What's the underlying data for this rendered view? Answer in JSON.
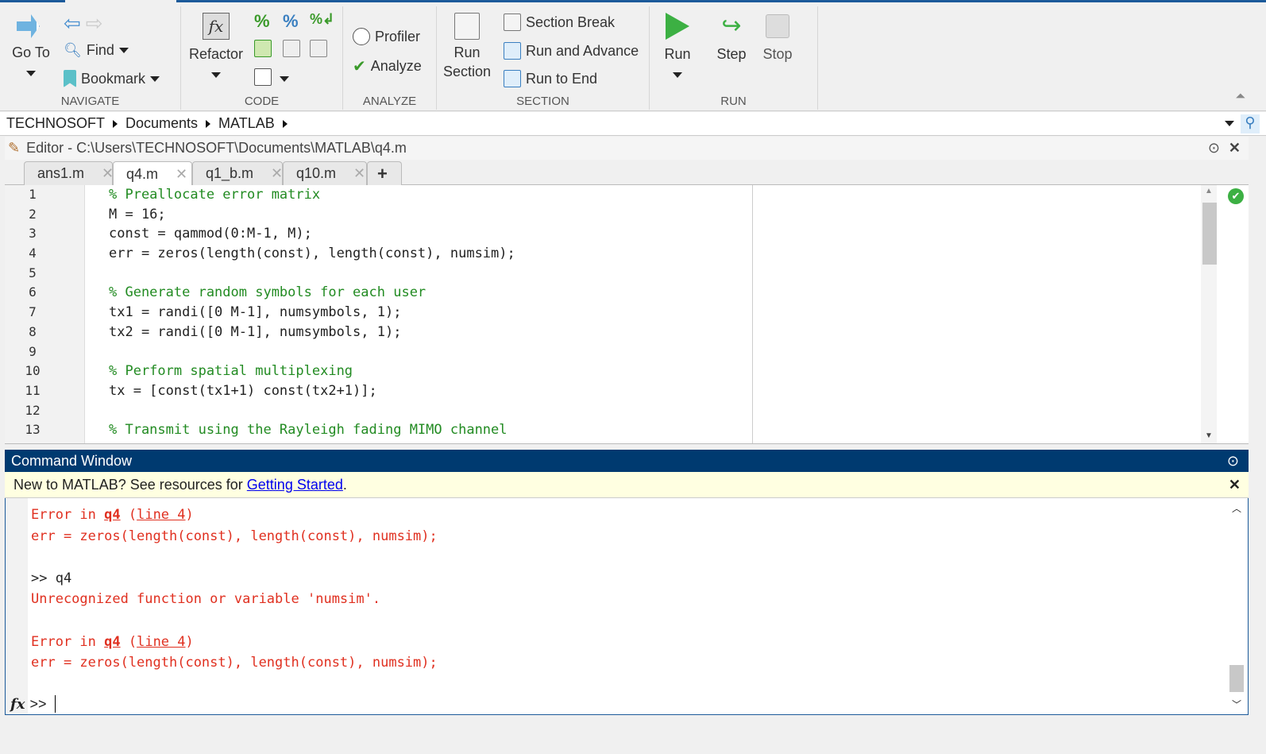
{
  "ribbon": {
    "navigate": {
      "label": "NAVIGATE",
      "goto": "Go To",
      "find": "Find",
      "bookmark": "Bookmark"
    },
    "code": {
      "label": "CODE",
      "refactor": "Refactor"
    },
    "analyze": {
      "label": "ANALYZE",
      "profiler": "Profiler",
      "analyze": "Analyze"
    },
    "section": {
      "label": "SECTION",
      "run_section_1": "Run",
      "run_section_2": "Section",
      "section_break": "Section Break",
      "run_and_advance": "Run and Advance",
      "run_to_end": "Run to End"
    },
    "run": {
      "label": "RUN",
      "run": "Run",
      "step": "Step",
      "stop": "Stop"
    }
  },
  "address": [
    "TECHNOSOFT",
    "Documents",
    "MATLAB"
  ],
  "editor": {
    "title": "Editor - C:\\Users\\TECHNOSOFT\\Documents\\MATLAB\\q4.m",
    "tabs": [
      "ans1.m",
      "q4.m",
      "q1_b.m",
      "q10.m"
    ],
    "active_tab": "q4.m",
    "lines": [
      {
        "n": "1",
        "text": "% Preallocate error matrix",
        "comment": true
      },
      {
        "n": "2",
        "text": "M = 16;"
      },
      {
        "n": "3",
        "text": "const = qammod(0:M-1, M);"
      },
      {
        "n": "4",
        "text": "err = zeros(length(const), length(const), numsim);"
      },
      {
        "n": "5",
        "text": ""
      },
      {
        "n": "6",
        "text": "% Generate random symbols for each user",
        "comment": true
      },
      {
        "n": "7",
        "text": "tx1 = randi([0 M-1], numsymbols, 1);"
      },
      {
        "n": "8",
        "text": "tx2 = randi([0 M-1], numsymbols, 1);"
      },
      {
        "n": "9",
        "text": ""
      },
      {
        "n": "10",
        "text": "% Perform spatial multiplexing",
        "comment": true
      },
      {
        "n": "11",
        "text": "tx = [const(tx1+1) const(tx2+1)];"
      },
      {
        "n": "12",
        "text": ""
      },
      {
        "n": "13",
        "text": "% Transmit using the Rayleigh fading MIMO channel",
        "comment": true
      }
    ]
  },
  "command_window": {
    "title": "Command Window",
    "notice_text": "New to MATLAB? See resources for",
    "notice_link": "Getting Started",
    "notice_end": ".",
    "lines": {
      "e1_prefix": "Error in ",
      "e1_link": "q4",
      "e1_sp": " (",
      "e1_line": "line 4",
      "e1_end": ")",
      "e1_code": "err = zeros(length(const), length(const), numsim);",
      "cmd": ">> q4",
      "msg": "Unrecognized function or variable 'numsim'.",
      "e2_prefix": "Error in ",
      "e2_link": "q4",
      "e2_sp": " (",
      "e2_line": "line 4",
      "e2_end": ")",
      "e2_code": "err = zeros(length(const), length(const), numsim);"
    },
    "prompt_fx": "fx",
    "prompt": ">>"
  }
}
